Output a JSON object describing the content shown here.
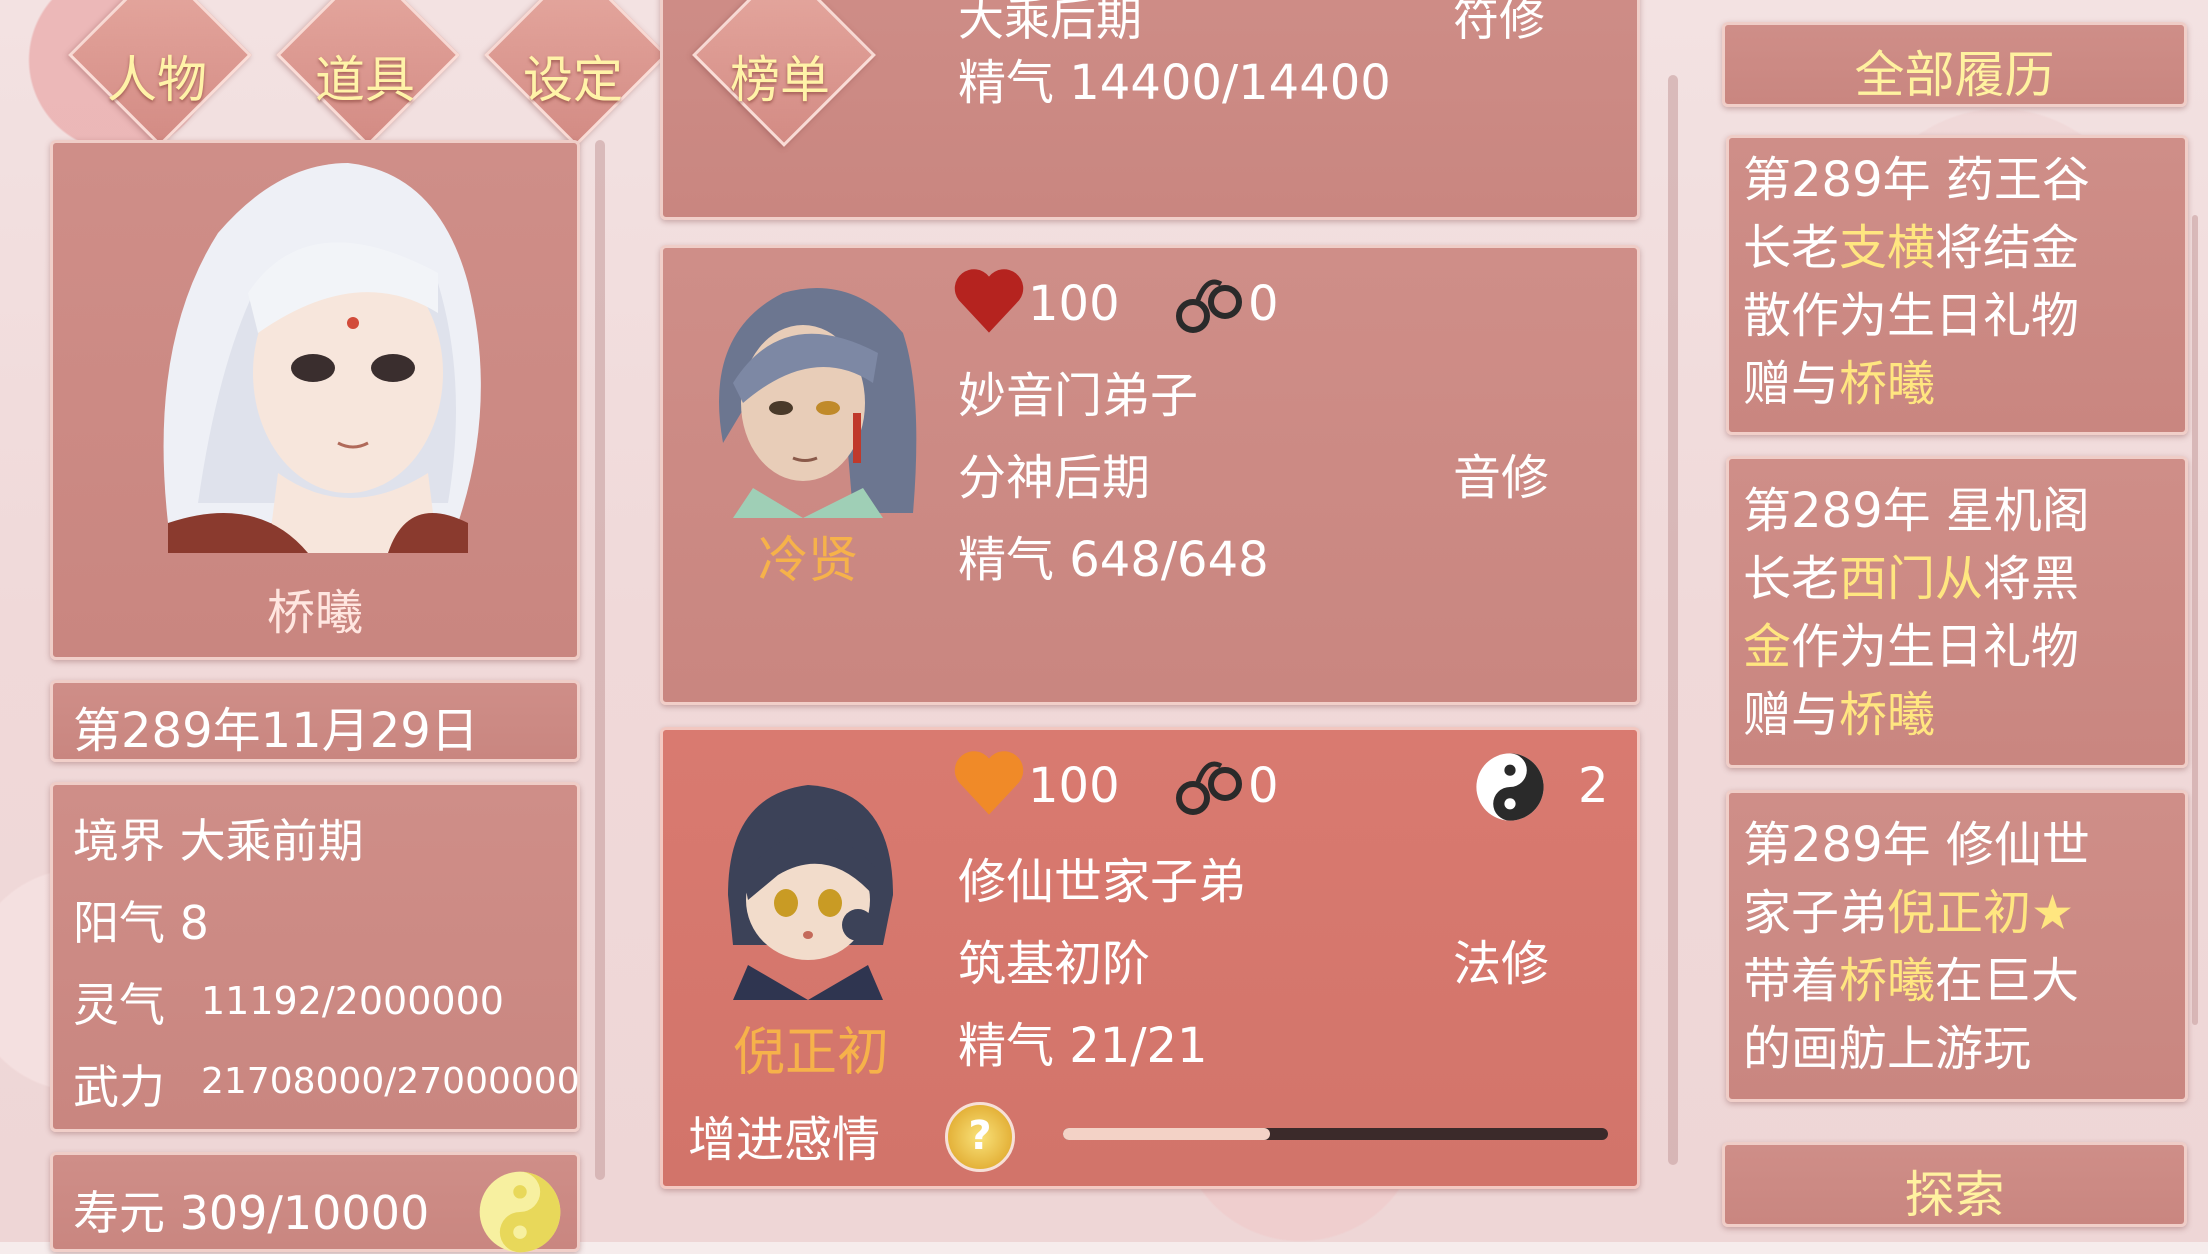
{
  "tabs": [
    {
      "label": "人物"
    },
    {
      "label": "道具"
    },
    {
      "label": "设定"
    },
    {
      "label": "榜单"
    }
  ],
  "player": {
    "name": "桥曦",
    "date": "第289年11月29日",
    "stats": {
      "realm": "境界 大乘前期",
      "yang": "阳气 8",
      "lingqi_label": "灵气",
      "lingqi_value": "11192/2000000",
      "wuli_label": "武力",
      "wuli_value": "21708000/27000000"
    },
    "lifespan": "寿元 309/10000"
  },
  "cards": [
    {
      "partial_top": "大乘后期",
      "partial_right": "符修",
      "jingqi": "精气 14400/14400"
    },
    {
      "name": "冷贤",
      "affection": "100",
      "bond": "0",
      "title": "妙音门弟子",
      "realm": "分神后期",
      "school": "音修",
      "jingqi": "精气 648/648",
      "heart_color": "#b5231f"
    },
    {
      "name": "倪正初",
      "affection": "100",
      "bond": "0",
      "yinyang_count": "2",
      "title": "修仙世家子弟",
      "realm": "筑基初阶",
      "school": "法修",
      "jingqi": "精气 21/21",
      "heart_color": "#f08a28",
      "action_label": "增进感情",
      "progress": 0.38
    }
  ],
  "history": {
    "header": "全部履历",
    "footer_button": "探索",
    "entries": [
      {
        "a": "第289年 药王谷",
        "b1": "长老",
        "b2": "支横",
        "b3": "将结金",
        "c": "散作为生日礼物",
        "d1": "赠与",
        "d2": "桥曦"
      },
      {
        "a": "第289年 星机阁",
        "b1": "长老",
        "b2": "西门从",
        "b3": "将黑",
        "c1": "金",
        "c2": "作为生日礼物",
        "d1": "赠与",
        "d2": "桥曦"
      },
      {
        "a": "第289年 修仙世",
        "b1": "家子弟",
        "b2": "倪正初★",
        "c1": "带着",
        "c2": "桥曦",
        "c3": "在巨大",
        "d": "的画舫上游玩"
      }
    ]
  },
  "colors": {
    "panel": "#cf8e88",
    "gold_text": "#ffe680",
    "heart_red": "#b5231f",
    "heart_orange": "#f08a28"
  }
}
